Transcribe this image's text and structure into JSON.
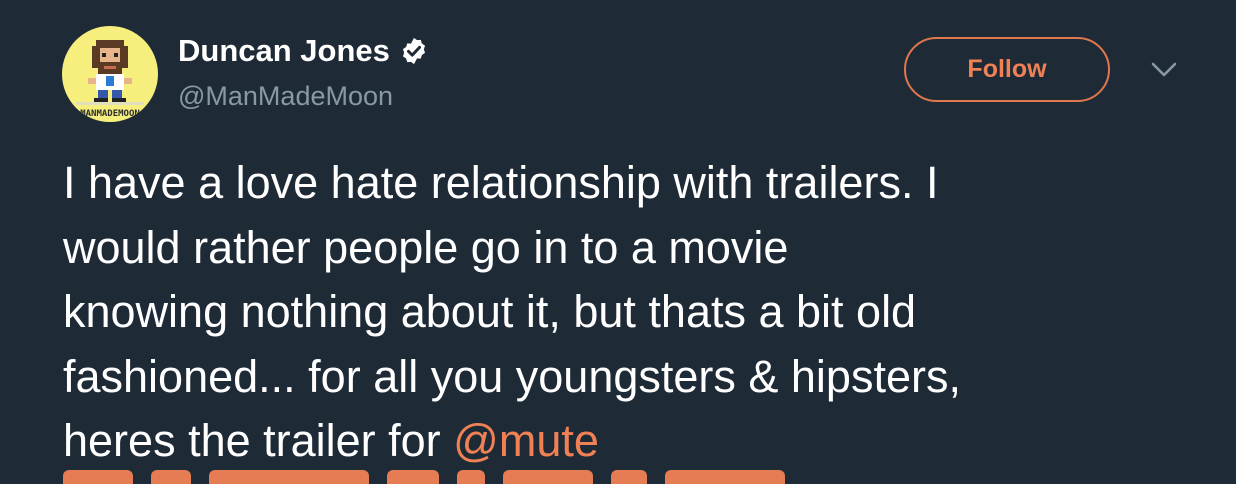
{
  "tweet": {
    "author": {
      "display_name": "Duncan Jones",
      "handle": "@ManMadeMoon",
      "verified": true,
      "avatar_text": "MANMADEMOON"
    },
    "follow_label": "Follow",
    "text_lines": [
      "I have a love hate relationship with trailers.  I",
      "would rather people go in to a movie",
      "knowing nothing about it, but thats a bit old",
      "fashioned... for all you youngsters & hipsters,"
    ],
    "last_line_prefix": "heres the trailer for ",
    "mention": "@mute"
  },
  "colors": {
    "background": "#1f2a37",
    "accent": "#f08155",
    "text": "#ffffff",
    "muted": "#8899a6",
    "verified_badge": "#ffffff"
  },
  "icons": {
    "verified": "verified-badge-icon",
    "menu": "chevron-down-icon"
  }
}
